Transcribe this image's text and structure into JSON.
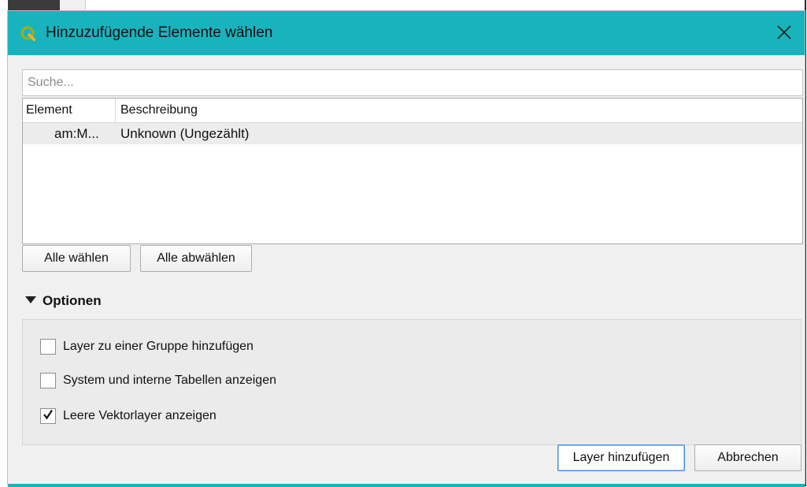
{
  "dialog": {
    "title": "Hinzuzufügende Elemente wählen",
    "accent_color": "#19b3bd",
    "icons": {
      "app": "qgis-logo-icon",
      "close": "close-icon"
    }
  },
  "search": {
    "placeholder": "Suche...",
    "value": ""
  },
  "table": {
    "columns": [
      "Element",
      "Beschreibung"
    ],
    "rows": [
      {
        "element": "am:M...",
        "description": "Unknown (Ungezählt)"
      }
    ]
  },
  "selection_buttons": {
    "select_all": "Alle wählen",
    "deselect_all": "Alle abwählen"
  },
  "options": {
    "label": "Optionen",
    "expanded": true,
    "items": [
      {
        "label": "Layer zu einer Gruppe hinzufügen",
        "checked": false
      },
      {
        "label": "System und interne Tabellen anzeigen",
        "checked": false
      },
      {
        "label": "Leere Vektorlayer anzeigen",
        "checked": true
      }
    ]
  },
  "footer": {
    "add_layer": "Layer hinzufügen",
    "cancel": "Abbrechen"
  }
}
